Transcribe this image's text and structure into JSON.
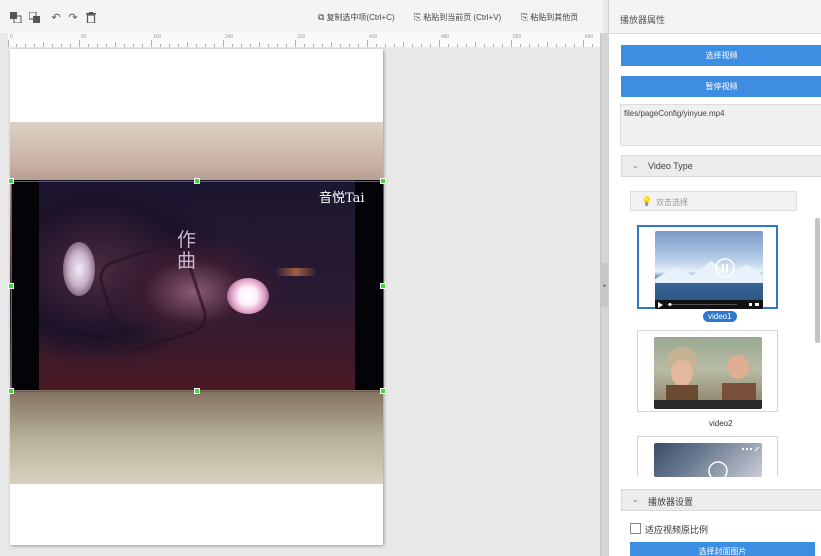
{
  "toolbar": {
    "icons": [
      "move-up-icon",
      "move-down-icon",
      "undo-icon",
      "redo-icon",
      "delete-icon"
    ],
    "copy_label": "复制选中项(Ctrl+C)",
    "paste_current_label": "粘贴到当前页 (Ctrl+V)",
    "paste_other_label": "粘贴到其他页"
  },
  "ruler": {
    "labels": [
      "0",
      "80",
      "160",
      "240",
      "320",
      "400",
      "480",
      "560",
      "640"
    ]
  },
  "canvas": {
    "video_overlay_title": "音悦Tai",
    "video_overlay_chars": "作曲"
  },
  "panel": {
    "title": "播放器属性",
    "select_video_label": "选择视频",
    "pause_video_label": "暂停视频",
    "file_path": "files/pageConfig/yinyue.mp4",
    "video_type": {
      "header": "Video Type",
      "hint": "双击选择",
      "thumbnails": [
        {
          "label": "video1",
          "selected": true
        },
        {
          "label": "video2",
          "selected": false
        }
      ]
    },
    "player_settings": {
      "header": "播放器设置",
      "fit_ratio_label": "适应视频原比例",
      "fit_ratio_checked": false,
      "cover_button_label": "选择封面图片"
    }
  },
  "colors": {
    "accent": "#3d8ee3",
    "selection_outline": "#c0392b",
    "handle": "#3ddc3d"
  }
}
